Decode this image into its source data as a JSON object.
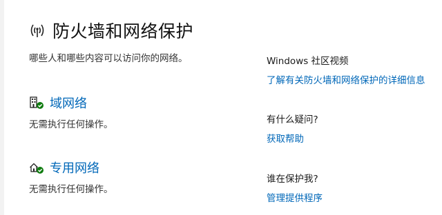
{
  "page": {
    "title": "防火墙和网络保护",
    "subtitle": "哪些人和哪些内容可以访问你的网络。",
    "header_icon": "wifi-signal-icon"
  },
  "networks": {
    "domain": {
      "label": "域网络",
      "status": "无需执行任何操作。",
      "icon": "building-check-icon"
    },
    "private": {
      "label": "专用网络",
      "status": "无需执行任何操作。",
      "icon": "home-network-check-icon"
    }
  },
  "side": {
    "video": {
      "heading": "Windows 社区视频",
      "link": "了解有关防火墙和网络保护的详细信息"
    },
    "help": {
      "heading": "有什么疑问?",
      "link": "获取帮助"
    },
    "who": {
      "heading": "谁在保护我?",
      "link": "管理提供程序"
    }
  },
  "colors": {
    "link": "#0067b8",
    "check": "#107c10",
    "text": "#1a1a1a"
  }
}
